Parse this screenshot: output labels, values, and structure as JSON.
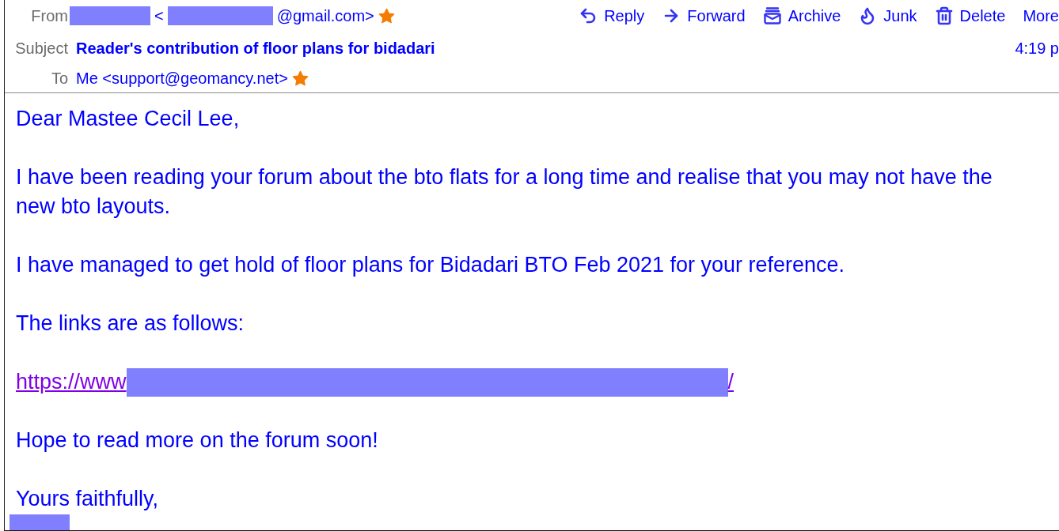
{
  "header": {
    "from": {
      "label": "From",
      "parts": [
        {
          "kind": "redacted"
        },
        {
          "kind": "text",
          "text": "<"
        },
        {
          "kind": "redacted"
        },
        {
          "kind": "text",
          "text": "@gmail.com>"
        }
      ],
      "starred": true
    },
    "subject": {
      "label": "Subject",
      "text": "Reader's contribution of floor plans for bidadari"
    },
    "to": {
      "label": "To",
      "text": "Me <support@geomancy.net>",
      "starred": true
    },
    "time": "4:19 p"
  },
  "toolbar": [
    {
      "kind": "reply",
      "label": "Reply"
    },
    {
      "kind": "forward",
      "label": "Forward"
    },
    {
      "kind": "archive",
      "label": "Archive"
    },
    {
      "kind": "junk",
      "label": "Junk"
    },
    {
      "kind": "delete",
      "label": "Delete"
    },
    {
      "kind": "more",
      "label": "More"
    }
  ],
  "body": [
    {
      "kind": "text",
      "text": "Dear Mastee Cecil Lee,"
    },
    {
      "kind": "text",
      "text": "I have been reading your forum about the bto flats for a long time and realise that you may not have the new bto layouts."
    },
    {
      "kind": "text",
      "text": "I have managed to get hold of floor plans for Bidadari BTO Feb 2021 for your reference."
    },
    {
      "kind": "text",
      "text": "The links are as follows:"
    },
    {
      "kind": "link",
      "parts": [
        {
          "kind": "text",
          "text": "https://www"
        },
        {
          "kind": "redacted"
        },
        {
          "kind": "text",
          "text": "/"
        }
      ]
    },
    {
      "kind": "text",
      "text": "Hope to read more on the forum soon!"
    },
    {
      "kind": "text",
      "text": "Yours faithfully,"
    },
    {
      "kind": "redacted"
    }
  ]
}
